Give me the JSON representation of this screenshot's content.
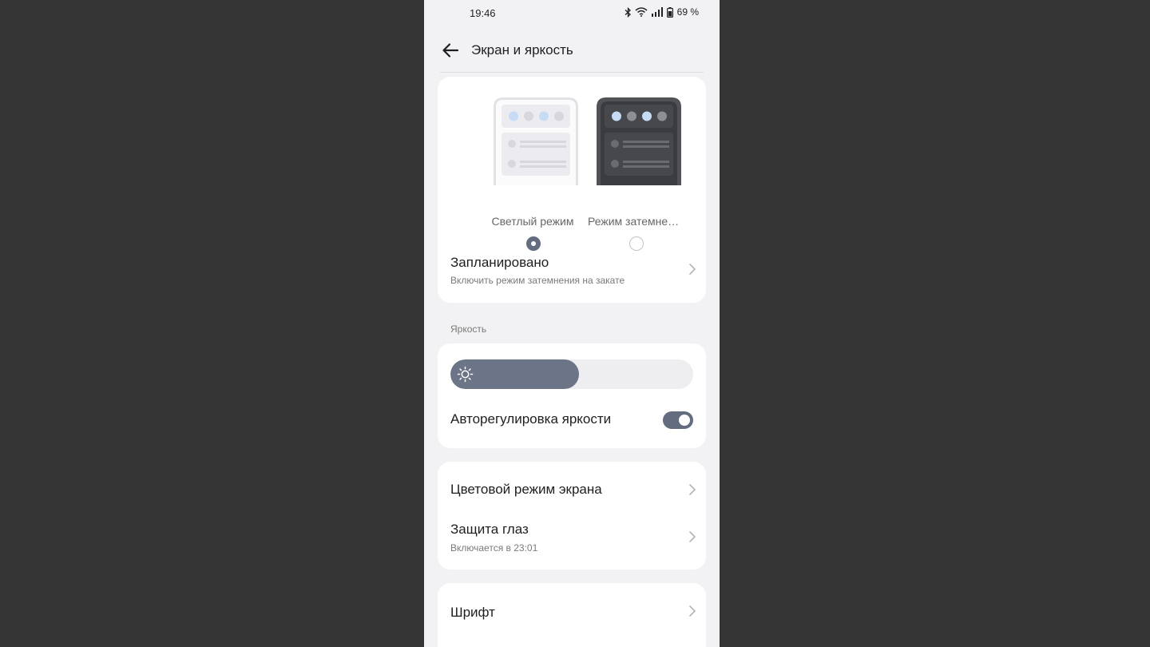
{
  "status_bar": {
    "time": "19:46",
    "battery": "69 %",
    "icons": [
      "bluetooth-icon",
      "wifi-icon",
      "signal-icon",
      "battery-icon"
    ]
  },
  "header": {
    "title": "Экран и яркость",
    "back_icon": "arrow-left-icon"
  },
  "theme": {
    "light_label": "Светлый режим",
    "dark_label": "Режим затемнения",
    "selected": "light"
  },
  "scheduled": {
    "title": "Запланировано",
    "subtitle": "Включить режим затемнения на закате"
  },
  "brightness": {
    "section_label": "Яркость",
    "level": 0.53,
    "auto_label": "Авторегулировка яркости",
    "auto_enabled": true
  },
  "display": {
    "color_mode": "Цветовой режим экрана",
    "eye_protection": "Защита глаз",
    "eye_protection_sub": "Включается в 23:01"
  },
  "font": {
    "title": "Шрифт"
  },
  "colors": {
    "accent": "#646c80",
    "background": "#f2f2f4",
    "card": "#ffffff",
    "outer": "#353535"
  }
}
